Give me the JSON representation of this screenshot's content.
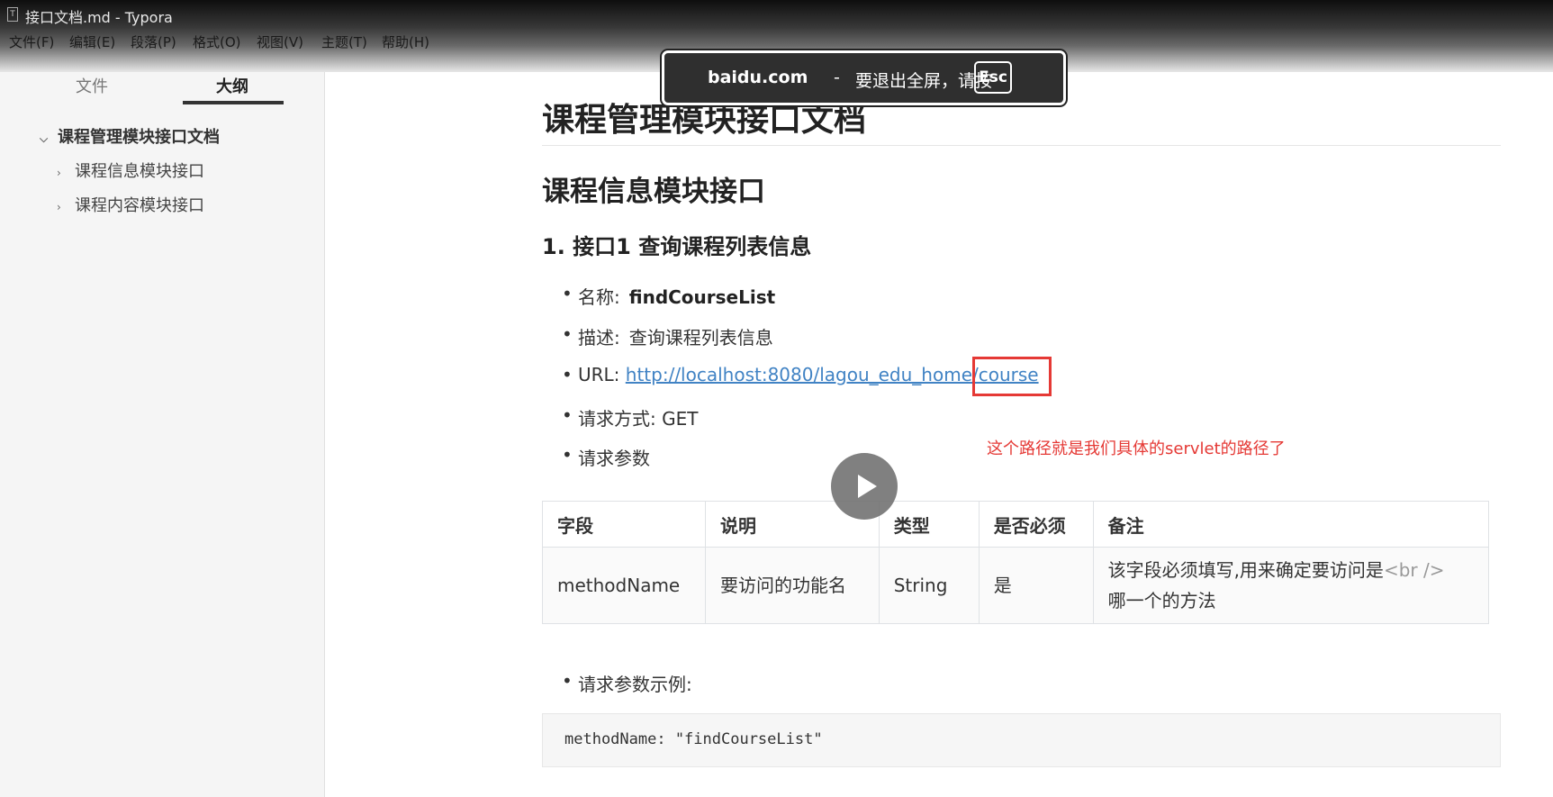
{
  "window": {
    "title": "接口文档.md - Typora",
    "icon": "T"
  },
  "menu": [
    "文件(F)",
    "编辑(E)",
    "段落(P)",
    "格式(O)",
    "视图(V)",
    "主题(T)",
    "帮助(H)"
  ],
  "sidebar": {
    "tabs": [
      "文件",
      "大纲"
    ],
    "active_tab": "大纲",
    "outline": [
      {
        "label": "课程管理模块接口文档",
        "expanded": true
      },
      {
        "label": "课程信息模块接口",
        "expanded": false
      },
      {
        "label": "课程内容模块接口",
        "expanded": false
      }
    ]
  },
  "doc": {
    "h1": "课程管理模块接口文档",
    "h2": "课程信息模块接口",
    "h3": "1. 接口1 查询课程列表信息",
    "items": {
      "name_label": "名称:",
      "name_value": "findCourseList",
      "desc_label": "描述:",
      "desc_value": "查询课程列表信息",
      "url_label": "URL:",
      "url_value": "http://localhost:8080/lagou_edu_home/course",
      "method": "请求方式: GET",
      "params": "请求参数",
      "example": "请求参数示例:"
    },
    "table": {
      "headers": [
        "字段",
        "说明",
        "类型",
        "是否必须",
        "备注"
      ],
      "row": {
        "field": "methodName",
        "desc": "要访问的功能名",
        "type": "String",
        "required": "是",
        "note_line1": "该字段必须填写,用来确定要访问是",
        "note_br": "<br />",
        "note_line2": "哪一个的方法"
      }
    },
    "code": "methodName: \"findCourseList\""
  },
  "annotation": "这个路径就是我们具体的servlet的路径了",
  "toast": {
    "domain": "baidu.com",
    "separator": "-",
    "message": "要退出全屏，请按",
    "key": "Esc"
  },
  "colors": {
    "link": "#4183c4",
    "annotation": "#e53935",
    "sidebar_bg": "#f5f5f5"
  },
  "icons": {
    "play": "play-icon",
    "outline_chevron": "chevron-icon"
  }
}
